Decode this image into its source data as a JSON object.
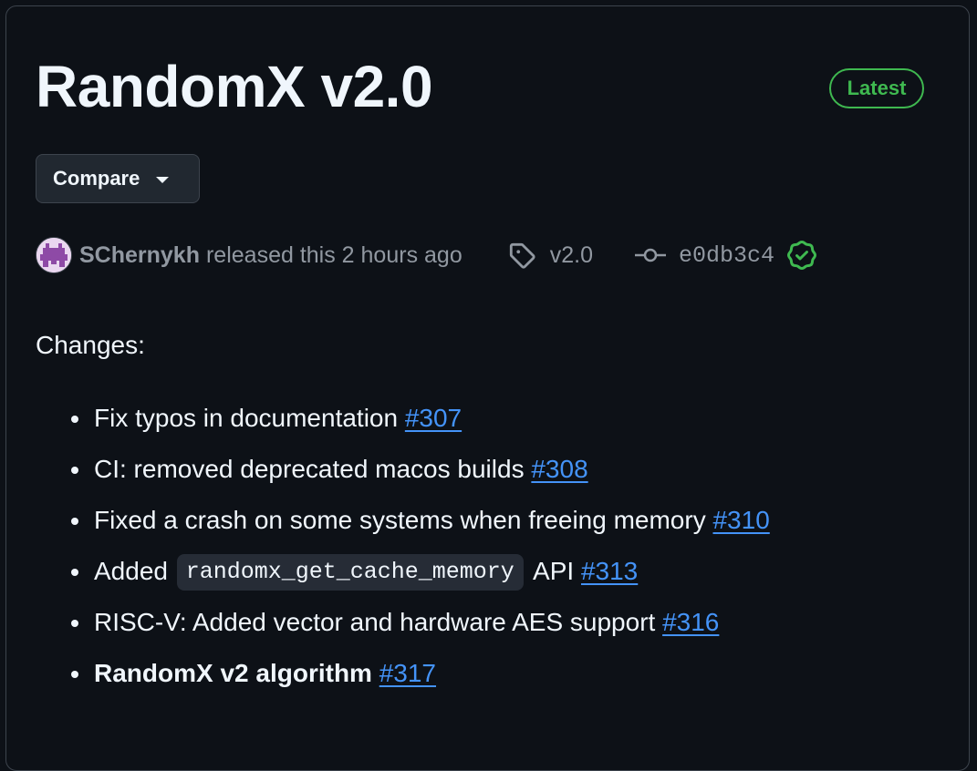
{
  "release": {
    "title": "RandomX v2.0",
    "badge": "Latest",
    "compare_label": "Compare",
    "author": "SChernykh",
    "released_text": "released this 2 hours ago",
    "tag": "v2.0",
    "commit": "e0db3c4",
    "verified": true
  },
  "notes": {
    "heading": "Changes:",
    "items": [
      {
        "text": "Fix typos in documentation",
        "pr": "#307"
      },
      {
        "text": "CI: removed deprecated macos builds",
        "pr": "#308"
      },
      {
        "text": "Fixed a crash on some systems when freeing memory",
        "pr": "#310"
      },
      {
        "text_before": "Added",
        "code": "randomx_get_cache_memory",
        "text_after": "API",
        "pr": "#313"
      },
      {
        "text": "RISC-V: Added vector and hardware AES support",
        "pr": "#316"
      },
      {
        "text": "RandomX v2 algorithm",
        "pr": "#317",
        "bold": true
      }
    ]
  },
  "colors": {
    "background": "#0d1117",
    "text": "#f0f6fc",
    "muted": "#9198a1",
    "link": "#4493f8",
    "success": "#3fb950",
    "border": "#3d444d"
  },
  "icons": {
    "tag": "tag-icon",
    "commit": "git-commit-icon",
    "verified": "verified-badge-icon",
    "dropdown": "triangle-down-icon"
  }
}
